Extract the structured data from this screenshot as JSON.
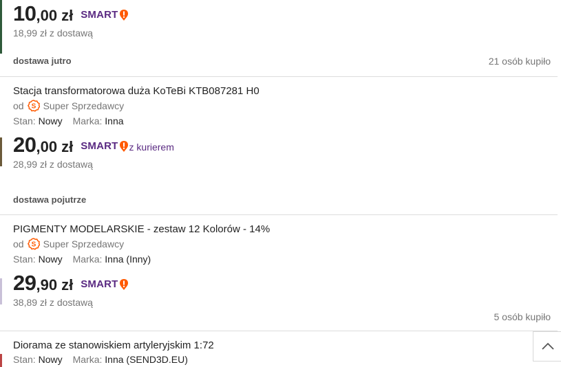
{
  "offers": [
    {
      "price_int": "10",
      "price_frac": ",00",
      "currency": "zł",
      "smart": "SMART",
      "delivery_price": "18,99 zł z dostawą",
      "shipping": "dostawa jutro",
      "bought": "21 osób kupiło"
    },
    {
      "title": "Stacja transformatorowa duża KoTeBi KTB087281 H0",
      "seller_prefix": "od",
      "seller_name": "Super Sprzedawcy",
      "stan_label": "Stan:",
      "stan_value": "Nowy",
      "marka_label": "Marka:",
      "marka_value": "Inna",
      "price_int": "20",
      "price_frac": ",00",
      "currency": "zł",
      "smart": "SMART",
      "smart_suffix": "z kurierem",
      "delivery_price": "28,99 zł z dostawą",
      "shipping": "dostawa pojutrze"
    },
    {
      "title": "PIGMENTY MODELARSKIE - zestaw 12 Kolorów - 14%",
      "seller_prefix": "od",
      "seller_name": "Super Sprzedawcy",
      "stan_label": "Stan:",
      "stan_value": "Nowy",
      "marka_label": "Marka:",
      "marka_value": "Inna (Inny)",
      "price_int": "29",
      "price_frac": ",90",
      "currency": "zł",
      "smart": "SMART",
      "delivery_price": "38,89 zł z dostawą",
      "bought": "5 osób kupiło"
    },
    {
      "title": "Diorama ze stanowiskiem artyleryjskim 1:72",
      "stan_label": "Stan:",
      "stan_value": "Nowy",
      "marka_label": "Marka:",
      "marka_value": "Inna (SEND3D.EU)"
    }
  ],
  "colors": {
    "smart_purple": "#5a2a82",
    "smart_orange": "#ff5a00",
    "super_seller_orange": "#ff5a00"
  },
  "icons": {
    "smart_badge": "exclamation-badge-icon",
    "super_seller": "super-seller-badge-icon",
    "scroll_top": "chevron-up-icon"
  }
}
